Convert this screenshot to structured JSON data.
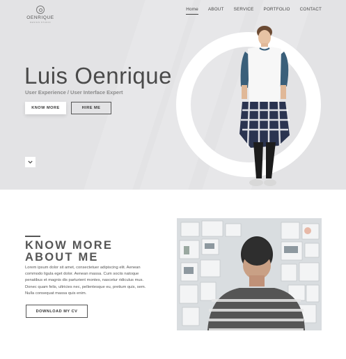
{
  "brand": {
    "name": "OENRIQUE",
    "tagline": "DESIGN STUDIO"
  },
  "nav": [
    {
      "label": "Home",
      "active": true
    },
    {
      "label": "ABOUT",
      "active": false
    },
    {
      "label": "SERVICE",
      "active": false
    },
    {
      "label": "PORTFOLIO",
      "active": false
    },
    {
      "label": "CONTACT",
      "active": false
    }
  ],
  "hero": {
    "title": "Luis Oenrique",
    "subtitle": "User Experience / User Interface Expert",
    "know_more_label": "KNOW MORE",
    "hire_me_label": "HIRE ME",
    "scroll_icon": "chevron-down-icon"
  },
  "about": {
    "title_line1": "KNOW MORE",
    "title_line2": "ABOUT ME",
    "body": "Lorem ipsum dolor sit amet, consectetuer adipiscing elit. Aenean commodo ligula eget dolor. Aenean massa. Cum sociis natoque penatibus et magnis dis parturient montes, nascetur ridiculus mus. Donec quam felis, ultricies nec, pellentesque eu, pretium quis, sem. Nulla consequat massa quis enim.",
    "cv_label": "DOWNLOAD MY CV"
  },
  "colors": {
    "hero_bg": "#e3e3e5",
    "text_dark": "#4a4a4a",
    "accent_shirt": "#3a5f7a"
  }
}
